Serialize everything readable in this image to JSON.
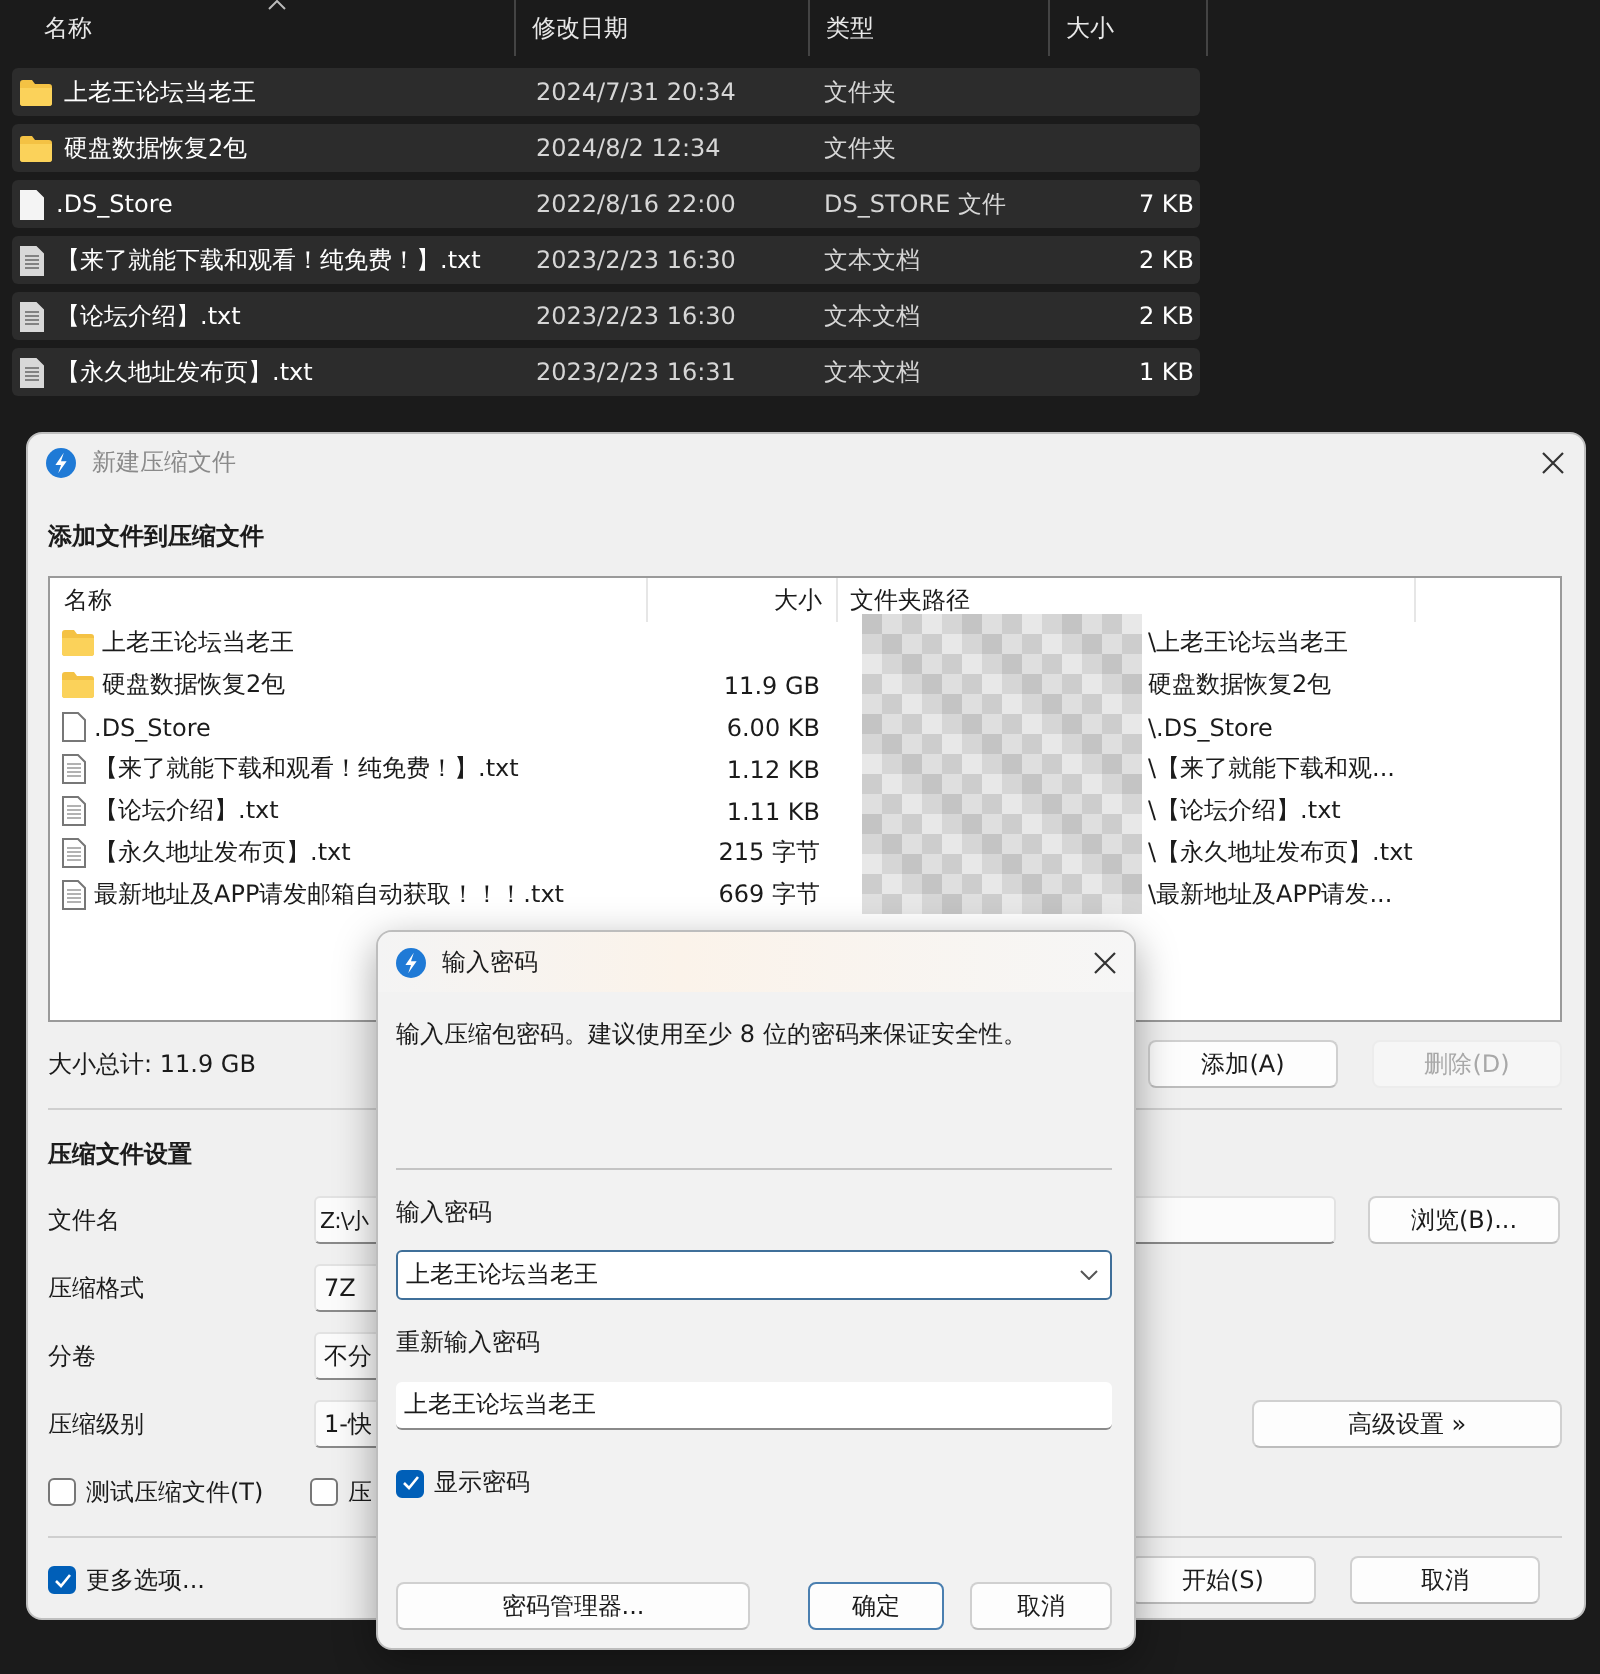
{
  "explorer": {
    "columns": [
      {
        "label": "名称",
        "sorted": true
      },
      {
        "label": "修改日期",
        "sorted": false
      },
      {
        "label": "类型",
        "sorted": false
      },
      {
        "label": "大小",
        "sorted": false
      }
    ],
    "rows": [
      {
        "kind": "folder",
        "name": "上老王论坛当老王",
        "date": "2024/7/31 20:34",
        "type": "文件夹",
        "selected": true
      },
      {
        "kind": "folder",
        "name": "硬盘数据恢复2包",
        "date": "2024/8/2 12:34",
        "type": "文件夹",
        "selected": true
      },
      {
        "kind": "file",
        "name": ".DS_Store",
        "date": "2022/8/16 22:00",
        "type": "DS_STORE 文件",
        "size": "7 KB",
        "selected": true
      },
      {
        "kind": "text",
        "name": "【来了就能下载和观看！纯免费！】.txt",
        "date": "2023/2/23 16:30",
        "type": "文本文档",
        "size": "2 KB",
        "selected": true
      },
      {
        "kind": "text",
        "name": "【论坛介绍】.txt",
        "date": "2023/2/23 16:30",
        "type": "文本文档",
        "size": "2 KB",
        "selected": true
      },
      {
        "kind": "text",
        "name": "【永久地址发布页】.txt",
        "date": "2023/2/23 16:31",
        "type": "文本文档",
        "size": "1 KB",
        "selected": true
      }
    ]
  },
  "archive_dialog": {
    "title": "新建压缩文件",
    "heading": "添加文件到压缩文件",
    "columns": [
      "名称",
      "大小",
      "文件夹路径"
    ],
    "rows": [
      {
        "kind": "folder",
        "name": "上老王论坛当老王",
        "path": "\\上老王论坛当老王"
      },
      {
        "kind": "folder",
        "name": "硬盘数据恢复2包",
        "size": "11.9 GB",
        "path": "硬盘数据恢复2包"
      },
      {
        "kind": "file",
        "name": ".DS_Store",
        "size": "6.00 KB",
        "path": "\\.DS_Store"
      },
      {
        "kind": "text",
        "name": "【来了就能下载和观看！纯免费！】.txt",
        "size": "1.12 KB",
        "path": "\\【来了就能下载和观..."
      },
      {
        "kind": "text",
        "name": "【论坛介绍】.txt",
        "size": "1.11 KB",
        "path": "\\【论坛介绍】.txt"
      },
      {
        "kind": "text",
        "name": "【永久地址发布页】.txt",
        "size": "215 字节",
        "path": "\\【永久地址发布页】.txt"
      },
      {
        "kind": "text",
        "name": "最新地址及APP请发邮箱自动获取！！！.txt",
        "size": "669 字节",
        "path": "\\最新地址及APP请发..."
      }
    ],
    "total": "大小总计: 11.9 GB",
    "add_button": {
      "label": "添加(A)",
      "disabled": false
    },
    "delete_button": {
      "label": "删除(D)",
      "disabled": true
    },
    "settings_heading": "压缩文件设置",
    "settings": [
      {
        "label": "文件名",
        "value": "Z:\\小"
      },
      {
        "label": "压缩格式",
        "value": "7Z"
      },
      {
        "label": "分卷",
        "value": "不分"
      },
      {
        "label": "压缩级别",
        "value": "1-快"
      }
    ],
    "browse_button": "浏览(B)...",
    "advanced_button": "高级设置 »",
    "options": [
      {
        "label": "测试压缩文件(T)",
        "checked": false
      },
      {
        "label": "压",
        "checked": false
      }
    ],
    "more_options": {
      "label": "更多选项...",
      "checked": true
    },
    "start_button": "开始(S)",
    "cancel_button": "取消"
  },
  "password_dialog": {
    "title": "输入密码",
    "description": "输入压缩包密码。建议使用至少 8 位的密码来保证安全性。",
    "password_label": "输入密码",
    "password_value": "上老王论坛当老王",
    "confirm_label": "重新输入密码",
    "confirm_value": "上老王论坛当老王",
    "show_password": {
      "label": "显示密码",
      "checked": true
    },
    "manager_button": "密码管理器...",
    "ok_button": {
      "label": "确定",
      "default": true
    },
    "cancel_button": {
      "label": "取消",
      "default": false
    }
  }
}
